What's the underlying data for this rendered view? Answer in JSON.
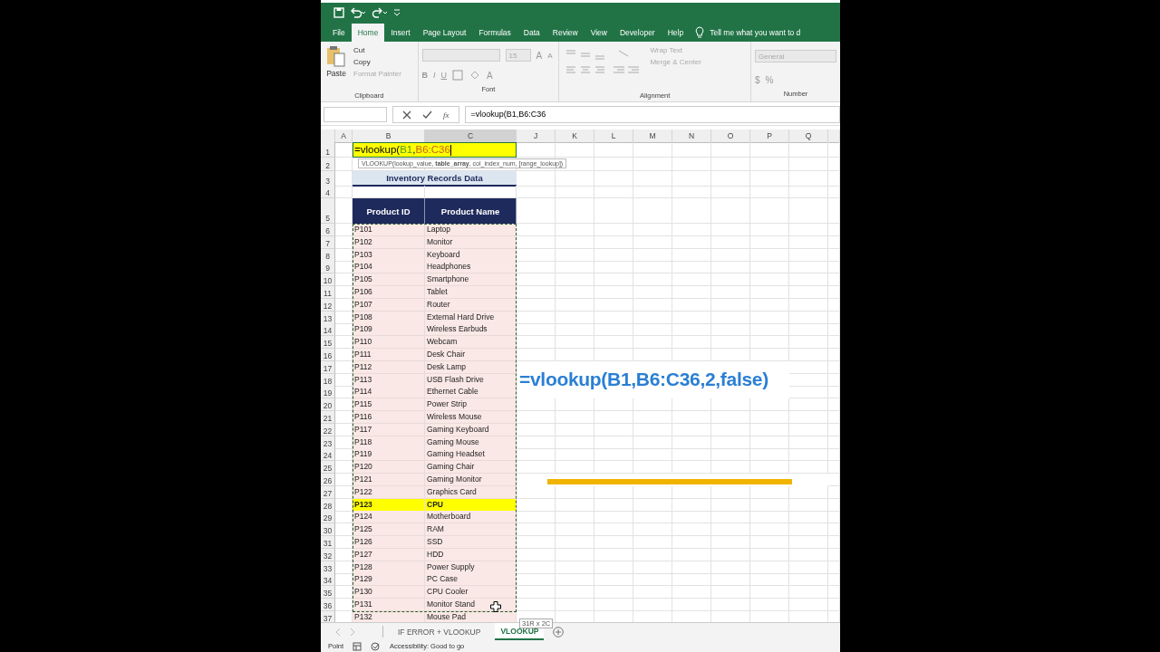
{
  "ribbon_tabs": [
    {
      "label": "File",
      "selected": false
    },
    {
      "label": "Home",
      "selected": true
    },
    {
      "label": "Insert",
      "selected": false
    },
    {
      "label": "Page Layout",
      "selected": false
    },
    {
      "label": "Formulas",
      "selected": false
    },
    {
      "label": "Data",
      "selected": false
    },
    {
      "label": "Review",
      "selected": false
    },
    {
      "label": "View",
      "selected": false
    },
    {
      "label": "Developer",
      "selected": false
    },
    {
      "label": "Help",
      "selected": false
    }
  ],
  "tell_me": "Tell me what you want to d",
  "clipboard": {
    "label": "Clipboard",
    "paste": "Paste",
    "items": [
      {
        "label": "Cut",
        "disabled": false
      },
      {
        "label": "Copy",
        "disabled": false
      },
      {
        "label": "Format Painter",
        "disabled": true
      }
    ]
  },
  "font": {
    "label": "Font",
    "size": "15",
    "buttons": [
      "B",
      "I",
      "U"
    ],
    "grow": "A",
    "shrink": "A",
    "color_letter": "A"
  },
  "alignment": {
    "label": "Alignment",
    "items": [
      {
        "label": "Wrap Text",
        "disabled": true
      },
      {
        "label": "Merge & Center",
        "disabled": true
      }
    ]
  },
  "number": {
    "label": "Number",
    "format": "General",
    "symbols": [
      "$",
      "%"
    ]
  },
  "formula_bar": {
    "function_symbol": "fx",
    "formula": "=vlookup(B1,B6:C36"
  },
  "columns": [
    {
      "label": "A",
      "selected": false
    },
    {
      "label": "B",
      "selected": false
    },
    {
      "label": "C",
      "selected": true
    },
    {
      "label": "J",
      "selected": false
    },
    {
      "label": "K",
      "selected": false
    },
    {
      "label": "L",
      "selected": false
    },
    {
      "label": "M",
      "selected": false
    },
    {
      "label": "N",
      "selected": false
    },
    {
      "label": "O",
      "selected": false
    },
    {
      "label": "P",
      "selected": false
    },
    {
      "label": "Q",
      "selected": false
    }
  ],
  "top_row_numbers": [
    "1",
    "2",
    "3",
    "4",
    "5"
  ],
  "edit_cell": {
    "segments": [
      {
        "text": "=vlookup("
      },
      {
        "text": "B1",
        "color": "#4e9a2c"
      },
      {
        "text": ","
      },
      {
        "text": "B6:C36",
        "color": "#c9621a"
      }
    ]
  },
  "tooltip": "VLOOKUP(lookup_value, **table_array**, col_index_num, [range_lookup])",
  "table_title": "Inventory Records Data",
  "headers": [
    "Product ID",
    "Product Name"
  ],
  "rows": [
    {
      "n": "6",
      "id": "P101",
      "name": "Laptop",
      "selected": false
    },
    {
      "n": "7",
      "id": "P102",
      "name": "Monitor",
      "selected": false
    },
    {
      "n": "8",
      "id": "P103",
      "name": "Keyboard",
      "selected": false
    },
    {
      "n": "9",
      "id": "P104",
      "name": "Headphones",
      "selected": false
    },
    {
      "n": "10",
      "id": "P105",
      "name": "Smartphone",
      "selected": false
    },
    {
      "n": "11",
      "id": "P106",
      "name": "Tablet",
      "selected": false
    },
    {
      "n": "12",
      "id": "P107",
      "name": "Router",
      "selected": false
    },
    {
      "n": "13",
      "id": "P108",
      "name": "External Hard Drive",
      "selected": false
    },
    {
      "n": "14",
      "id": "P109",
      "name": "Wireless Earbuds",
      "selected": false
    },
    {
      "n": "15",
      "id": "P110",
      "name": "Webcam",
      "selected": false
    },
    {
      "n": "16",
      "id": "P111",
      "name": "Desk Chair",
      "selected": false
    },
    {
      "n": "17",
      "id": "P112",
      "name": "Desk Lamp",
      "selected": false
    },
    {
      "n": "18",
      "id": "P113",
      "name": "USB Flash Drive",
      "selected": false
    },
    {
      "n": "19",
      "id": "P114",
      "name": "Ethernet Cable",
      "selected": false
    },
    {
      "n": "20",
      "id": "P115",
      "name": "Power Strip",
      "selected": false
    },
    {
      "n": "21",
      "id": "P116",
      "name": "Wireless Mouse",
      "selected": false
    },
    {
      "n": "22",
      "id": "P117",
      "name": "Gaming Keyboard",
      "selected": false
    },
    {
      "n": "23",
      "id": "P118",
      "name": "Gaming Mouse",
      "selected": false
    },
    {
      "n": "24",
      "id": "P119",
      "name": "Gaming Headset",
      "selected": false
    },
    {
      "n": "25",
      "id": "P120",
      "name": "Gaming Chair",
      "selected": false
    },
    {
      "n": "26",
      "id": "P121",
      "name": "Gaming Monitor",
      "selected": false
    },
    {
      "n": "27",
      "id": "P122",
      "name": "Graphics Card",
      "selected": false
    },
    {
      "n": "28",
      "id": "P123",
      "name": "CPU",
      "selected": true
    },
    {
      "n": "29",
      "id": "P124",
      "name": "Motherboard",
      "selected": false
    },
    {
      "n": "30",
      "id": "P125",
      "name": "RAM",
      "selected": false
    },
    {
      "n": "31",
      "id": "P126",
      "name": "SSD",
      "selected": false
    },
    {
      "n": "32",
      "id": "P127",
      "name": "HDD",
      "selected": false
    },
    {
      "n": "33",
      "id": "P128",
      "name": "Power Supply",
      "selected": false
    },
    {
      "n": "34",
      "id": "P129",
      "name": "PC Case",
      "selected": false
    },
    {
      "n": "35",
      "id": "P130",
      "name": "CPU Cooler",
      "selected": false
    },
    {
      "n": "36",
      "id": "P131",
      "name": "Monitor Stand",
      "selected": false
    }
  ],
  "partial_row": {
    "n": "37",
    "id": "P132",
    "name": "Mouse Pad"
  },
  "overlay_caption": "=vlookup(B1,B6:C36,2,false)",
  "selection_size": "31R x 2C",
  "sheet_tabs": [
    {
      "label": "IF ERROR + VLOOKUP",
      "selected": false
    },
    {
      "label": "VLOOKUP",
      "selected": true
    }
  ],
  "status": {
    "mode": "Point",
    "accessibility": "Accessibility: Good to go"
  }
}
